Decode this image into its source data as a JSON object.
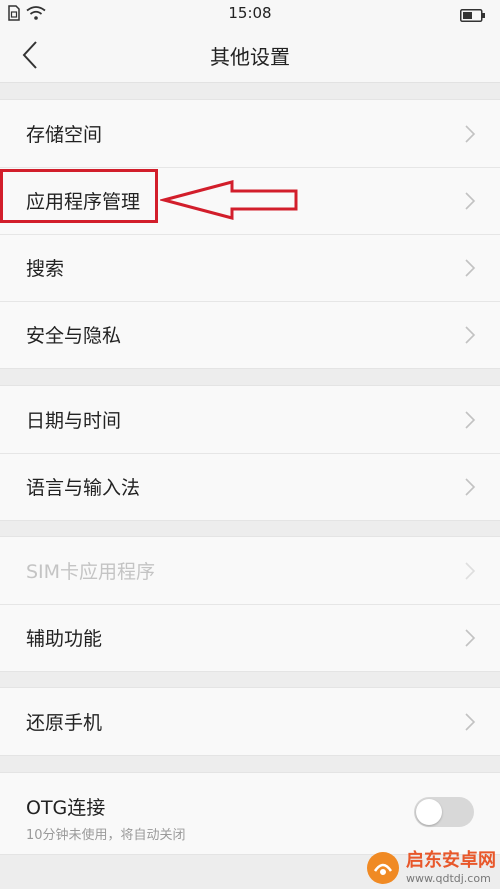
{
  "status_bar": {
    "time": "15:08"
  },
  "header": {
    "title": "其他设置"
  },
  "groups": [
    {
      "items": [
        {
          "label": "存储空间"
        },
        {
          "label": "应用程序管理"
        },
        {
          "label": "搜索"
        },
        {
          "label": "安全与隐私"
        }
      ]
    },
    {
      "items": [
        {
          "label": "日期与时间"
        },
        {
          "label": "语言与输入法"
        }
      ]
    },
    {
      "items": [
        {
          "label": "SIM卡应用程序",
          "disabled": true
        },
        {
          "label": "辅助功能"
        }
      ]
    },
    {
      "items": [
        {
          "label": "还原手机"
        }
      ]
    }
  ],
  "otg": {
    "label": "OTG连接",
    "sublabel": "10分钟未使用，将自动关闭",
    "enabled": false
  },
  "annotation": {
    "color": "#d21e2b"
  },
  "watermark": {
    "text": "启东安卓网",
    "url": "www.qdtdj.com"
  }
}
